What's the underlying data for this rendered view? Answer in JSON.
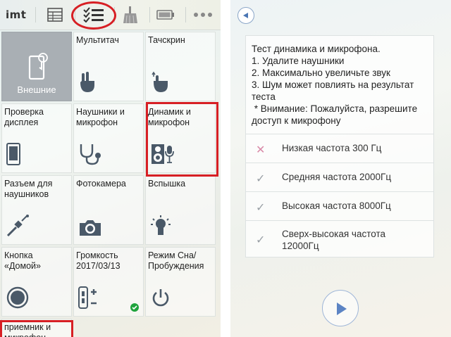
{
  "app": {
    "logo": "imt"
  },
  "toolbar": {
    "buttons": [
      "table-icon",
      "checklist-icon",
      "broom-icon",
      "battery-icon",
      "more-icon"
    ],
    "selected": "checklist-icon"
  },
  "tiles": [
    {
      "label": "Внешние",
      "icon": "phone-touch-icon"
    },
    {
      "label": "Мультитач",
      "icon": "multitouch-icon"
    },
    {
      "label": "Тачскрин",
      "icon": "touch-icon"
    },
    {
      "label": "Проверка дисплея",
      "icon": "display-icon"
    },
    {
      "label": "Наушники и микрофон",
      "icon": "stethoscope-icon"
    },
    {
      "label": "Динамик и микрофон",
      "icon": "speaker-mic-icon"
    },
    {
      "label": "Разъем для наушников",
      "icon": "jack-icon"
    },
    {
      "label": "Фотокамера",
      "icon": "camera-icon"
    },
    {
      "label": "Вспышка",
      "icon": "flash-icon"
    },
    {
      "label": "Кнопка «Домой»",
      "icon": "home-button-icon"
    },
    {
      "label": "Громкость",
      "date": "2017/03/13",
      "icon": "volume-icon"
    },
    {
      "label": "Режим Сна/ Пробуждения",
      "icon": "power-icon"
    },
    {
      "label": "приемник и микрофон",
      "icon": ""
    }
  ],
  "test": {
    "instructions": [
      "Тест динамика и микрофона.",
      "1. Удалите наушники",
      "2. Максимально увеличьте звук",
      "3. Шум может повлиять на результат",
      "теста",
      " * Внимание: Пожалуйста, разрешите",
      "доступ к микрофону"
    ],
    "options": [
      {
        "mark": "✕",
        "label": "Низкая частота 300 Гц",
        "status": "fail"
      },
      {
        "mark": "✓",
        "label": "Средняя частота 2000Гц",
        "status": "pass"
      },
      {
        "mark": "✓",
        "label": "Высокая частота 8000Гц",
        "status": "pass"
      },
      {
        "mark": "✓",
        "label": "Сверх-высокая частота",
        "label2": "12000Гц",
        "status": "pass"
      }
    ]
  },
  "colors": {
    "highlight": "#d71f24",
    "accent": "#4a76b4",
    "check": "#1fa33c"
  }
}
